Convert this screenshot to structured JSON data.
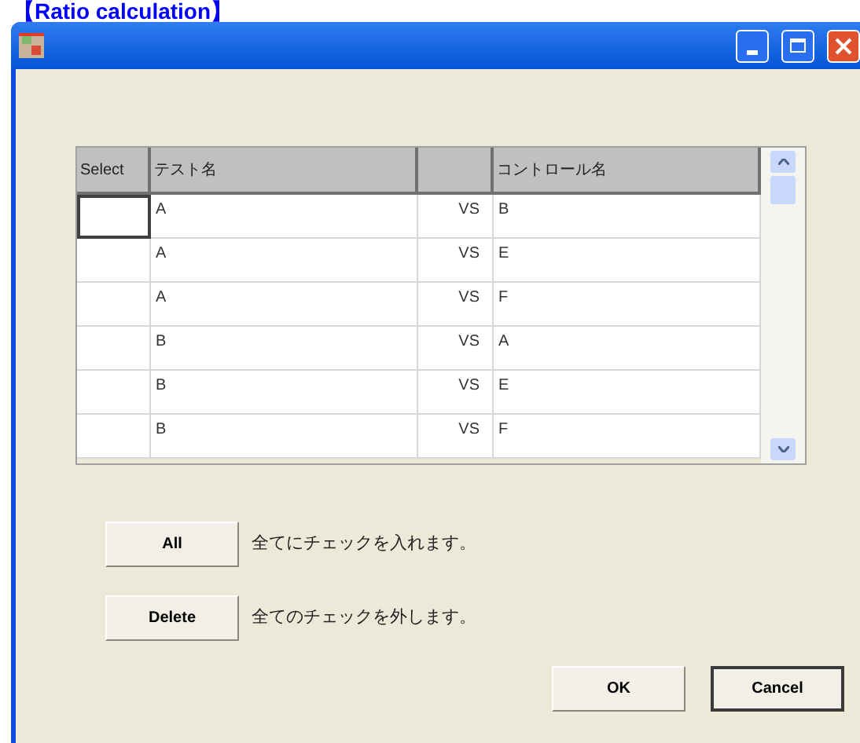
{
  "caption": "【Ratio calculation】",
  "table": {
    "columns": [
      "Select",
      "テスト名",
      null,
      "コントロール名"
    ],
    "rows": [
      {
        "test": "A",
        "vs": "VS",
        "control": "B",
        "focused": true
      },
      {
        "test": "A",
        "vs": "VS",
        "control": "E",
        "focused": false
      },
      {
        "test": "A",
        "vs": "VS",
        "control": "F",
        "focused": false
      },
      {
        "test": "B",
        "vs": "VS",
        "control": "A",
        "focused": false
      },
      {
        "test": "B",
        "vs": "VS",
        "control": "E",
        "focused": false
      },
      {
        "test": "B",
        "vs": "VS",
        "control": "F",
        "focused": false
      }
    ]
  },
  "actions": [
    {
      "button": "All",
      "description": "全てにチェックを入れます。"
    },
    {
      "button": "Delete",
      "description": "全てのチェックを外します。"
    }
  ],
  "buttons": [
    {
      "label": "OK",
      "default": false
    },
    {
      "label": "Cancel",
      "default": true
    }
  ]
}
